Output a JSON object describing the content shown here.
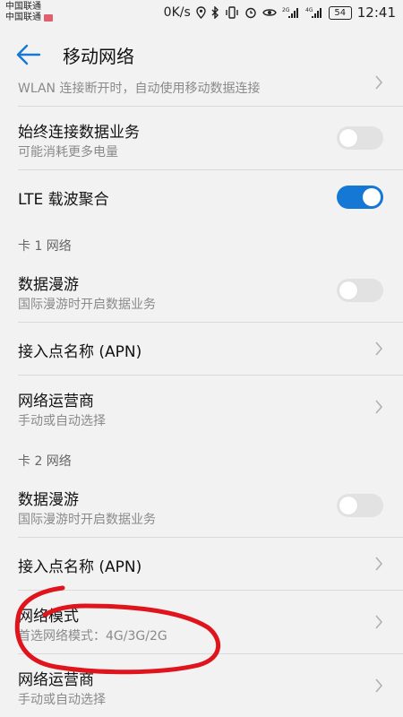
{
  "status_bar": {
    "carrier_1": "中国联通",
    "carrier_2": "中国联通",
    "speed": "0K/s",
    "battery": "54",
    "time": "12:41",
    "signal_1_label": "2G",
    "signal_2_label": "4G"
  },
  "header": {
    "title": "移动网络"
  },
  "rows": {
    "wlan_fallback": {
      "subtitle": "WLAN 连接断开时，自动使用移动数据连接"
    },
    "always_data": {
      "title": "始终连接数据业务",
      "subtitle": "可能消耗更多电量",
      "on": false
    },
    "lte_ca": {
      "title": "LTE 载波聚合",
      "on": true
    }
  },
  "card1": {
    "header": "卡 1 网络",
    "roaming": {
      "title": "数据漫游",
      "subtitle": "国际漫游时开启数据业务",
      "on": false
    },
    "apn": {
      "title": "接入点名称 (APN)"
    },
    "operator": {
      "title": "网络运营商",
      "subtitle": "手动或自动选择"
    }
  },
  "card2": {
    "header": "卡 2 网络",
    "roaming": {
      "title": "数据漫游",
      "subtitle": "国际漫游时开启数据业务",
      "on": false
    },
    "apn": {
      "title": "接入点名称 (APN)"
    },
    "network_mode": {
      "title": "网络模式",
      "subtitle": "首选网络模式：4G/3G/2G"
    },
    "operator": {
      "title": "网络运营商",
      "subtitle": "手动或自动选择"
    }
  },
  "colors": {
    "accent": "#1478d4",
    "annotation": "#e0141c"
  },
  "icons": [
    "back-arrow-icon",
    "chevron-right-icon",
    "bluetooth-icon",
    "location-icon",
    "vibrate-icon",
    "alarm-icon",
    "eye-icon",
    "signal-icon",
    "battery-icon"
  ]
}
